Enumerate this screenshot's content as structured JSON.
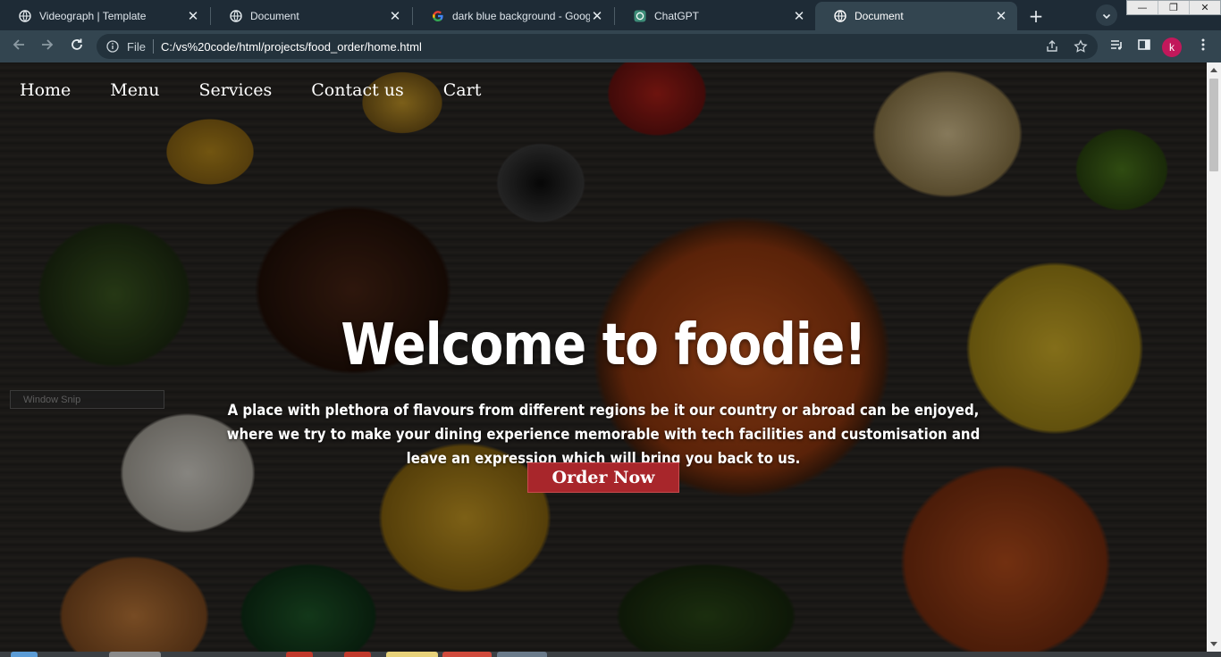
{
  "browser": {
    "tabs": [
      {
        "title": "Videograph | Template",
        "icon": "globe-icon",
        "active": false
      },
      {
        "title": "Document",
        "icon": "globe-icon",
        "active": false
      },
      {
        "title": "dark blue background - Google",
        "icon": "google-icon",
        "active": false
      },
      {
        "title": "ChatGPT",
        "icon": "chatgpt-icon",
        "active": false
      },
      {
        "title": "Document",
        "icon": "globe-icon",
        "active": true
      }
    ],
    "new_tab_label": "+",
    "window_buttons": {
      "minimize": "—",
      "restore": "❐",
      "close": "✕"
    },
    "address": {
      "scheme_label": "File",
      "url": "C:/vs%20code/html/projects/food_order/home.html"
    },
    "profile_initial": "k",
    "colors": {
      "tabstrip": "#1e2b36",
      "toolbar": "#334550",
      "profile": "#c2185b"
    }
  },
  "page": {
    "nav": {
      "items": [
        "Home",
        "Menu",
        "Services",
        "Contact us",
        "Cart"
      ]
    },
    "hero": {
      "heading": "Welcome to foodie!",
      "tagline": "A place with plethora of flavours from different regions be it our country or abroad can be enjoyed, where we try to make your dining experience memorable with tech facilities and customisation and leave an expression which will bring you back to us.",
      "cta_label": "Order Now"
    },
    "overlay_snip_label": "Window Snip",
    "colors": {
      "cta": "#a8262b",
      "text": "#ffffff"
    }
  }
}
